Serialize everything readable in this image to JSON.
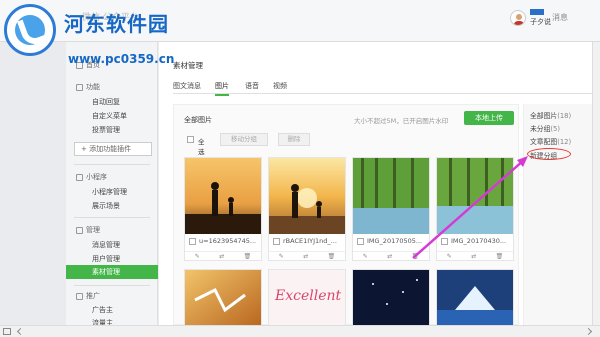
{
  "watermark": {
    "title": "河东软件园",
    "url": "www.pc0359.cn"
  },
  "header": {
    "brand": "微信·公众平台",
    "user_name": "子夕说",
    "messages_label": "消息"
  },
  "sidebar": {
    "sections": [
      {
        "label": "首页",
        "items": []
      },
      {
        "label": "功能",
        "items": [
          "自动回复",
          "自定义菜单",
          "投票管理"
        ]
      },
      {
        "label": "小程序",
        "items": [
          "小程序管理",
          "展示场景"
        ]
      },
      {
        "label": "管理",
        "items": [
          "消息管理",
          "用户管理",
          "素材管理"
        ]
      },
      {
        "label": "推广",
        "items": [
          "广告主",
          "流量主"
        ]
      }
    ],
    "add_plugin": "+ 添加功能插件"
  },
  "main": {
    "title": "素材管理",
    "tabs": [
      "图文消息",
      "图片",
      "语音",
      "视频"
    ],
    "active_tab": "图片",
    "panel": {
      "title": "全部图片",
      "upload_hint": "大小不超过5M，已开启图片水印",
      "upload_button": "本地上传",
      "select_all": "全选",
      "move_group": "移动分组",
      "delete": "删除"
    },
    "images": [
      {
        "name": "u=1623954745..."
      },
      {
        "name": "rBACE1IYJ1nd_..."
      },
      {
        "name": "IMG_20170505..."
      },
      {
        "name": "IMG_20170430..."
      },
      {
        "name": ""
      },
      {
        "name": ""
      },
      {
        "name": ""
      },
      {
        "name": ""
      }
    ],
    "thumb_texts": {
      "excellent": "Excellent"
    }
  },
  "categories": {
    "items": [
      {
        "label": "全部图片",
        "count": "(18)"
      },
      {
        "label": "未分组",
        "count": "(5)"
      },
      {
        "label": "文章配图",
        "count": "(12)"
      }
    ],
    "new_group": "新建分组"
  },
  "colors": {
    "accent": "#44b549",
    "highlight": "#e53935",
    "arrow": "#d63ad6",
    "watermark": "#1668c4"
  }
}
